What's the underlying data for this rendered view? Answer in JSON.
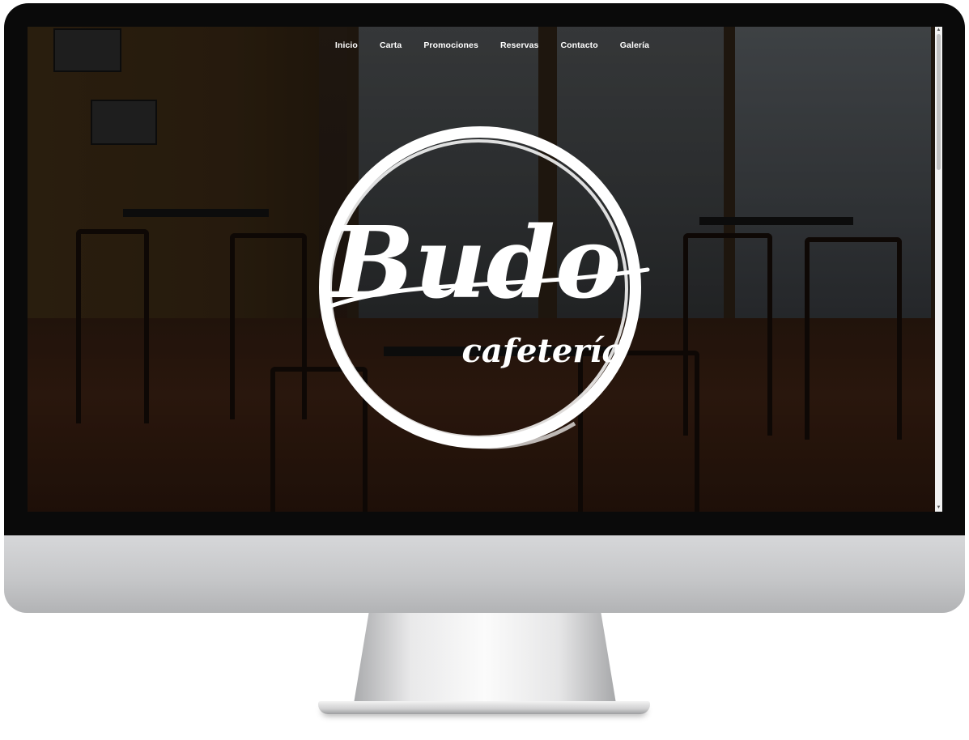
{
  "nav": {
    "items": [
      {
        "label": "Inicio"
      },
      {
        "label": "Carta"
      },
      {
        "label": "Promociones"
      },
      {
        "label": "Reservas"
      },
      {
        "label": "Contacto"
      },
      {
        "label": "Galería"
      }
    ]
  },
  "hero": {
    "logo_title": "Budo",
    "logo_subtitle": "cafetería"
  },
  "colors": {
    "nav_text": "#ffffff",
    "logo": "#ffffff",
    "bezel": "#0a0a0a",
    "monitor_body": "#c6c7c9"
  }
}
